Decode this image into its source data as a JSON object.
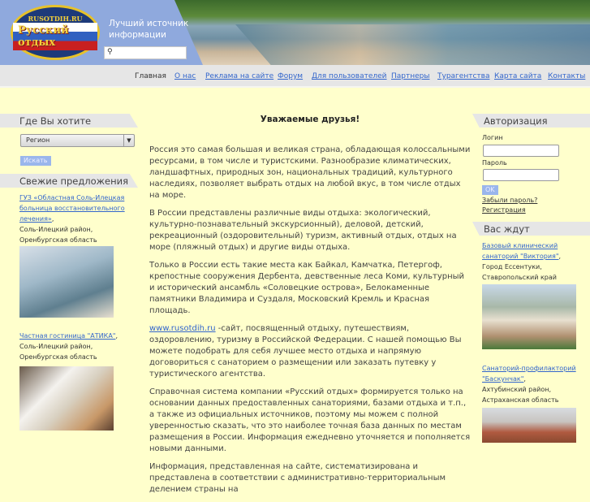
{
  "header": {
    "logo_text": "Русский отдых",
    "logo_small": "RUSOTDIH.RU",
    "tagline": "Лучший источник информации",
    "search_icon": "search-icon",
    "search_placeholder": ""
  },
  "nav": [
    {
      "label": "Главная",
      "current": true
    },
    {
      "label": "О нас"
    },
    {
      "label": "Реклама на сайте"
    },
    {
      "label": "Форум"
    },
    {
      "label": "Для пользователей"
    },
    {
      "label": "Партнеры"
    },
    {
      "label": "Турагентства"
    },
    {
      "label": "Карта сайта"
    },
    {
      "label": "Контакты"
    }
  ],
  "left": {
    "where_title": "Где Вы хотите отдохнуть?",
    "region_value": "Регион",
    "search_button": "Искать",
    "fresh_title": "Свежие предложения",
    "offers": [
      {
        "link": "ГУЗ «Областная Соль-Илецкая больница восстановительного лечения»",
        "location": "Соль-Илецкий район, Оренбургская область"
      },
      {
        "link": "Частная гостиница \"АТИКА\"",
        "location": "Соль-Илецкий район, Оренбургская область"
      }
    ]
  },
  "main": {
    "title": "Уважаемые друзья!",
    "p1": "Россия это самая большая и великая страна, обладающая колоссальными ресурсами, в том числе и туристскими. Разнообразие климатических, ландшафтных, природных зон, национальных традиций, культурного наследиях, позволяет выбрать отдых на любой вкус, в том числе отдых на море.",
    "p2": "В России представлены различные виды отдыха: экологический, культурно-познавательный  экскурсионный), деловой, детский, рекреационный (оздоровительный) туризм, активный отдых, отдых на море (пляжный отдых) и другие виды отдыха.",
    "p3": "Только в России есть такие места как Байкал, Камчатка, Петергоф, крепостные сооружения Дербента, девственные леса Коми, культурный и исторический ансамбль  «Соловецкие острова», Белокаменные памятники Владимира и Суздаля, Московский Кремль и Красная площадь.",
    "p4_link": "www.rusotdih.ru",
    "p4": " -сайт, посвященный отдыху, путешествиям, оздоровлению, туризму в Российской Федерации. С нашей помощью Вы можете подобрать для себя лучшее место отдыха и напрямую договориться с санаторием о размещении или заказать путевку у туристического агентства.",
    "p5": "Справочная система компании  «Русский отдых» формируется только на основании данных предоставленных санаториями, базами отдыха и т.п., а также из официальных источников, поэтому мы можем с полной уверенностью сказать, что это наиболее точная база данных по местам размещения в России. Информация ежедневно уточняется и пополняется новыми данными.",
    "p6": "Информация, представленная на сайте, систематизирована и представлена в соответствии с административно-территориальным делением страны на"
  },
  "right": {
    "auth_title": "Авторизация",
    "login_label": "Логин",
    "password_label": "Пароль",
    "ok": "OK",
    "forgot": "Забыли пароль?",
    "register": "Регистрация",
    "waiting_title": "Вас ждут",
    "offers": [
      {
        "link": "Базовый клинический санаторий \"Виктория\"",
        "location": "Город Ессентуки, Ставропольский край"
      },
      {
        "link": "Санаторий-профилакторий \"Баскунчак\"",
        "location": "Ахтубинский район, Астраханская область"
      }
    ]
  }
}
